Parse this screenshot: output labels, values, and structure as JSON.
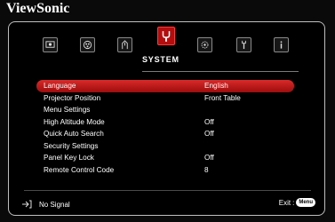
{
  "brand": "ViewSonic",
  "tabs": [
    {
      "name": "display",
      "active": false
    },
    {
      "name": "picture",
      "active": false
    },
    {
      "name": "power",
      "active": false
    },
    {
      "name": "system",
      "active": true,
      "label": "SYSTEM"
    },
    {
      "name": "advanced",
      "active": false
    },
    {
      "name": "maintenance",
      "active": false
    },
    {
      "name": "information",
      "active": false
    }
  ],
  "menu": [
    {
      "label": "Language",
      "value": "English",
      "selected": true
    },
    {
      "label": "Projector Position",
      "value": "Front Table"
    },
    {
      "label": "Menu Settings",
      "value": ""
    },
    {
      "label": "High Altitude Mode",
      "value": "Off"
    },
    {
      "label": "Quick Auto Search",
      "value": "Off"
    },
    {
      "label": "Security Settings",
      "value": ""
    },
    {
      "label": "Panel Key Lock",
      "value": "Off"
    },
    {
      "label": "Remote Control Code",
      "value": "8"
    }
  ],
  "footer": {
    "signal_text": "No Signal",
    "exit_label": "Exit",
    "menu_button": "Menu"
  },
  "colors": {
    "accent": "#c01818",
    "border": "#bfbfbf"
  }
}
